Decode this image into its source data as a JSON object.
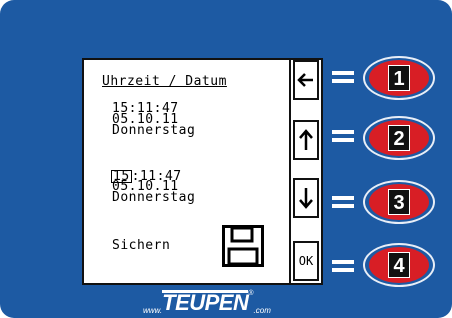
{
  "screen": {
    "title": "Uhrzeit / Datum",
    "current": {
      "time": "15:11:47",
      "date": "05.10.11",
      "weekday": "Donnerstag"
    },
    "edit": {
      "time_cursor_digit": "15",
      "time_rest": ":11:47",
      "date": "05.10.11",
      "weekday": "Donnerstag"
    },
    "save_label": "Sichern",
    "side_buttons": [
      {
        "icon": "arrow-left-icon"
      },
      {
        "icon": "arrow-up-icon"
      },
      {
        "icon": "arrow-down-icon"
      },
      {
        "label": "OK"
      }
    ]
  },
  "hardware_keys": [
    {
      "equals": "=",
      "number": "1"
    },
    {
      "equals": "=",
      "number": "2"
    },
    {
      "equals": "=",
      "number": "3"
    },
    {
      "equals": "=",
      "number": "4"
    }
  ],
  "brand": {
    "prefix": "www.",
    "name": "TEUPEN",
    "reg": "®",
    "suffix": ".com"
  },
  "colors": {
    "panel": "#1d5aa3",
    "key_red": "#d81e25",
    "key_black": "#111111",
    "lcd": "#ffffff"
  }
}
